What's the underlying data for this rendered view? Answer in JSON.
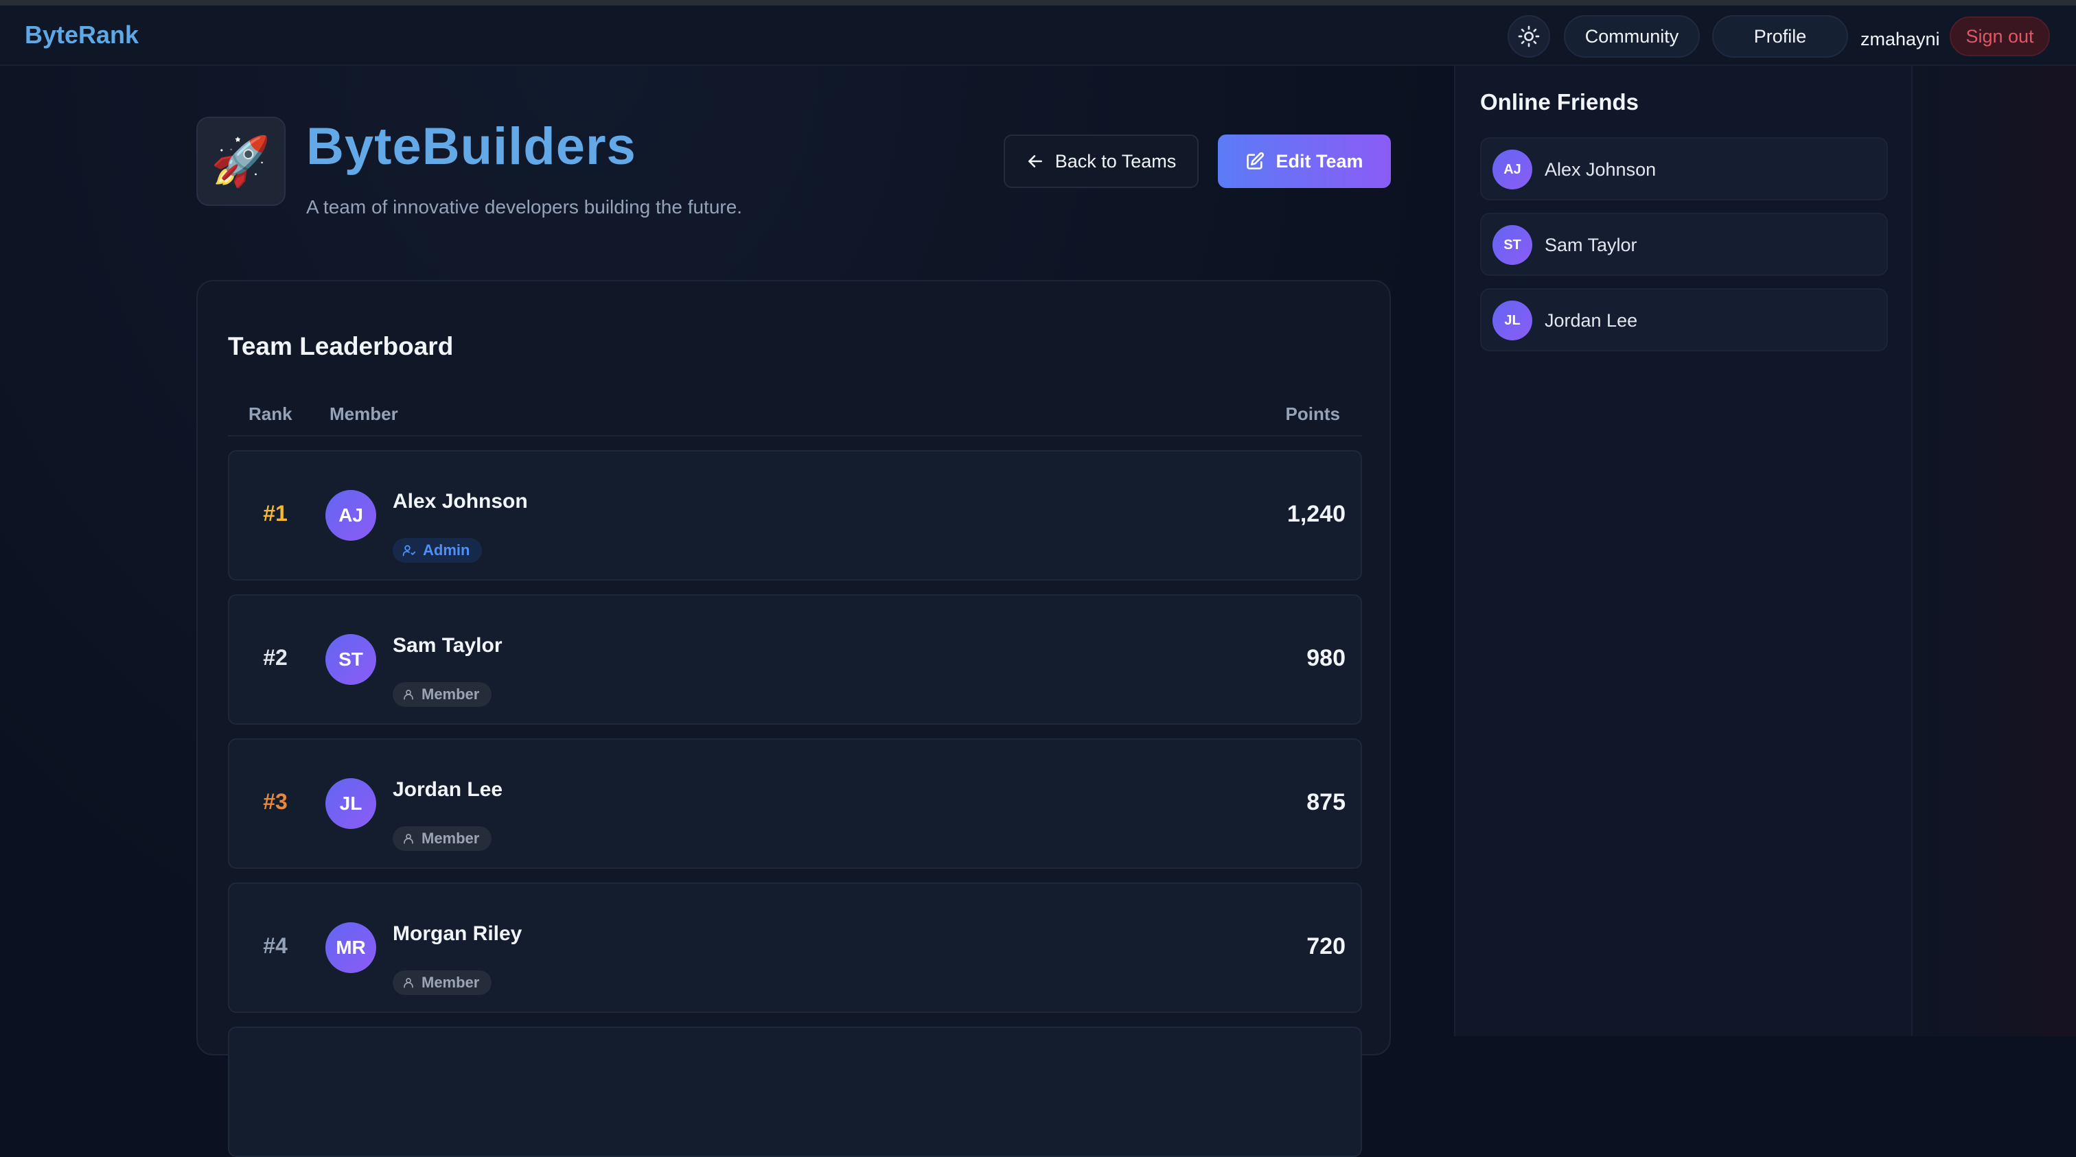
{
  "app": {
    "brand": "ByteRank"
  },
  "nav": {
    "theme_icon": "sun-icon",
    "community_label": "Community",
    "profile_label": "Profile",
    "username": "zmahayni",
    "signout_label": "Sign out"
  },
  "team": {
    "icon": "rocket-emoji",
    "emoji": "🚀",
    "name": "ByteBuilders",
    "description": "A team of innovative developers building the future.",
    "back_label": "Back to Teams",
    "edit_label": "Edit Team"
  },
  "leaderboard": {
    "title": "Team Leaderboard",
    "columns": {
      "rank": "Rank",
      "member": "Member",
      "points": "Points"
    },
    "rows": [
      {
        "rank": "#1",
        "initials": "AJ",
        "name": "Alex Johnson",
        "role": "Admin",
        "points": "1,240",
        "rank_color": "#f5b82e"
      },
      {
        "rank": "#2",
        "initials": "ST",
        "name": "Sam Taylor",
        "role": "Member",
        "points": "980",
        "rank_color": "#e2e8f0"
      },
      {
        "rank": "#3",
        "initials": "JL",
        "name": "Jordan Lee",
        "role": "Member",
        "points": "875",
        "rank_color": "#e8883a"
      },
      {
        "rank": "#4",
        "initials": "MR",
        "name": "Morgan Riley",
        "role": "Member",
        "points": "720",
        "rank_color": "#94a3b8"
      }
    ]
  },
  "sidebar": {
    "title": "Online Friends",
    "friends": [
      {
        "initials": "AJ",
        "name": "Alex Johnson"
      },
      {
        "initials": "ST",
        "name": "Sam Taylor"
      },
      {
        "initials": "JL",
        "name": "Jordan Lee"
      }
    ]
  },
  "colors": {
    "accent": "#5b7cf6",
    "accent_end": "#8b5cf6",
    "brand": "#5fa8e6",
    "danger": "#e05865"
  }
}
